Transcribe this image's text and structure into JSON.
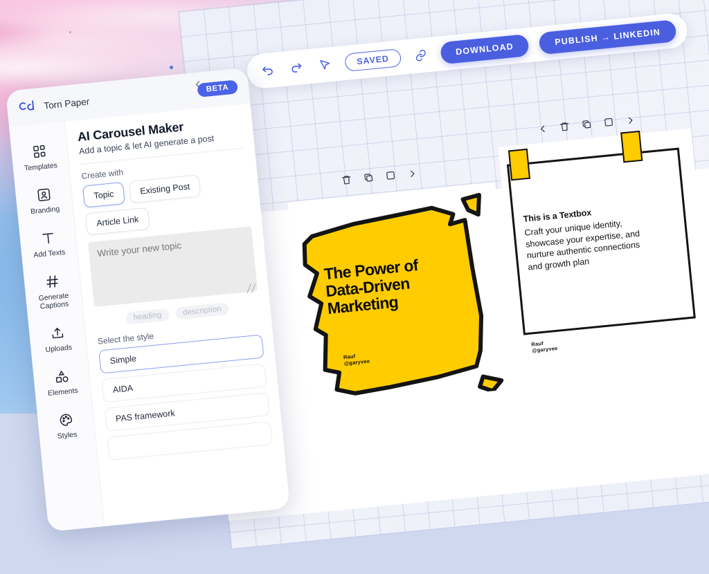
{
  "app": {
    "brand_logo": "cd-logo",
    "brand_name": "Torn Paper",
    "beta_badge": "BETA",
    "collapse_icon": "chevron-left-icon"
  },
  "toolbar": {
    "undo_icon": "undo-icon",
    "redo_icon": "redo-icon",
    "cursor_icon": "cursor-pointer-icon",
    "saved_label": "SAVED",
    "link_icon": "link-icon",
    "download_label": "DOWNLOAD",
    "publish_label": "PUBLISH → LINKEDIN",
    "accent_color": "#4a5fe0"
  },
  "sidebar": {
    "items": [
      {
        "label": "Templates",
        "icon": "grid-squares-icon"
      },
      {
        "label": "Branding",
        "icon": "user-frame-icon"
      },
      {
        "label": "Add Texts",
        "icon": "text-t-icon"
      },
      {
        "label": "Generate\nCaptions",
        "label_line1": "Generate",
        "label_line2": "Captions",
        "icon": "hash-icon"
      },
      {
        "label": "Uploads",
        "icon": "upload-arrow-icon"
      },
      {
        "label": "Elements",
        "icon": "shapes-icon"
      },
      {
        "label": "Styles",
        "icon": "palette-icon"
      }
    ]
  },
  "form": {
    "title": "AI Carousel Maker",
    "subtitle": "Add a topic & let AI generate a post",
    "create_with_label": "Create with",
    "create_with_options": [
      {
        "label": "Topic",
        "selected": true
      },
      {
        "label": "Existing Post",
        "selected": false
      },
      {
        "label": "Article Link",
        "selected": false
      }
    ],
    "topic_placeholder": "Write your new topic",
    "topic_value": "",
    "resize_handle": "resize-grip-icon",
    "tags": [
      "heading",
      "description"
    ],
    "style_label": "Select the style",
    "style_options": [
      {
        "label": "Simple",
        "selected": true
      },
      {
        "label": "AIDA",
        "selected": false
      },
      {
        "label": "PAS framework",
        "selected": false
      }
    ]
  },
  "canvas": {
    "card_tools": {
      "prev_icon": "chevron-left-icon",
      "delete_icon": "trash-icon",
      "duplicate_icon": "duplicate-icon",
      "frame_icon": "square-icon",
      "next_icon": "chevron-right-icon"
    },
    "cards": [
      {
        "type": "torn-paper-heading",
        "shape_color": "#FFCC00",
        "outline_color": "#141414",
        "heading_line1": "The Power of",
        "heading_line2": "Data-Driven",
        "heading_line3": "Marketing",
        "signature_name": "Rauf",
        "signature_handle": "@garyvee"
      },
      {
        "type": "textbox",
        "tape_color": "#FFCC00",
        "outline_color": "#141414",
        "textbox_title": "This is a Textbox",
        "textbox_body_line1": "Craft your unique identity,",
        "textbox_body_line2": "showcase your expertise, and",
        "textbox_body_line3": "nurture authentic connections",
        "textbox_body_line4": "and growth plan",
        "signature_name": "Rauf",
        "signature_handle": "@garyvee"
      },
      {
        "type": "textbox-empty",
        "tape_color": "#FFCC00",
        "outline_color": "#141414"
      }
    ]
  }
}
